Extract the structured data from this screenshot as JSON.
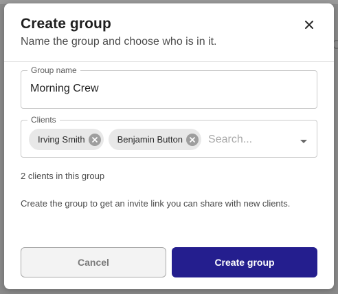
{
  "dialog": {
    "title": "Create group",
    "subtitle": "Name the group and choose who is in it."
  },
  "name_field": {
    "label": "Group name",
    "value": "Morning Crew"
  },
  "clients_field": {
    "label": "Clients",
    "chips": [
      "Irving Smith",
      "Benjamin Button"
    ],
    "placeholder": "Search..."
  },
  "count_text": "2 clients in this group",
  "info_text": "Create the group to get an invite link you can share with new clients.",
  "buttons": {
    "cancel": "Cancel",
    "create": "Create group"
  },
  "colors": {
    "primary": "#241e8e",
    "chip_background": "#e8e8e8"
  },
  "background": {
    "partial_text": "C"
  }
}
